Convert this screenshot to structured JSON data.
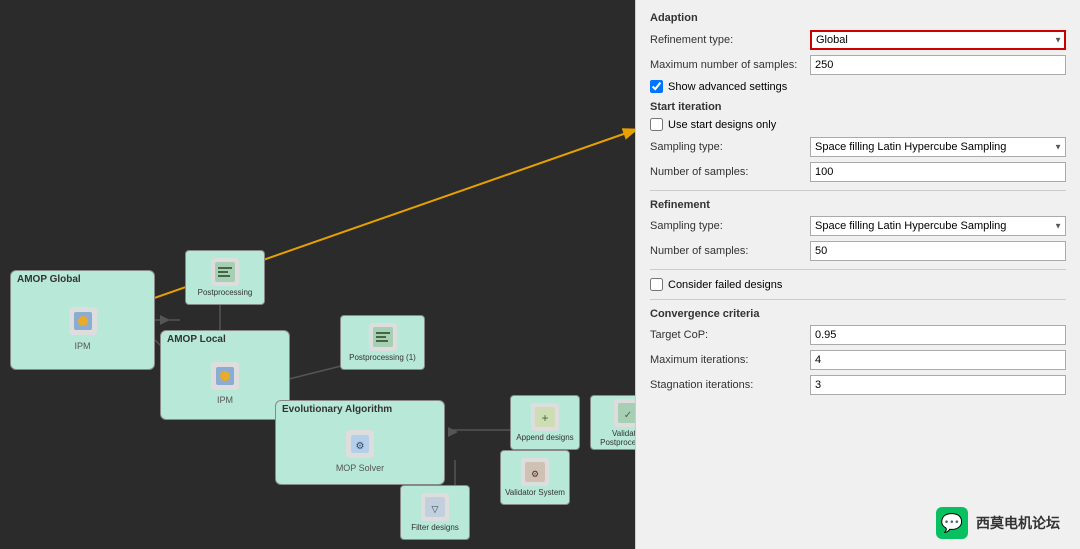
{
  "settings": {
    "section_adaption": "Adaption",
    "refinement_type_label": "Refinement type:",
    "refinement_type_value": "Global",
    "max_samples_label": "Maximum number of samples:",
    "max_samples_value": "250",
    "show_advanced_label": "Show advanced settings",
    "start_iteration_title": "Start iteration",
    "use_start_designs_label": "Use start designs only",
    "sampling_type_label": "Sampling type:",
    "sampling_type_value_start": "Space filling Latin Hypercube Sampling",
    "num_samples_label": "Number of samples:",
    "num_samples_value_start": "100",
    "refinement_title": "Refinement",
    "sampling_type_value_ref": "Space filling Latin Hypercube Sampling",
    "num_samples_value_ref": "50",
    "consider_failed_label": "Consider failed designs",
    "convergence_title": "Convergence criteria",
    "target_cop_label": "Target CoP:",
    "target_cop_value": "0.95",
    "max_iterations_label": "Maximum iterations:",
    "max_iterations_value": "4",
    "stagnation_label": "Stagnation iterations:",
    "stagnation_value": "3"
  },
  "workflow": {
    "nodes": {
      "amop_global_title": "AMOP Global",
      "amop_global_sub": "IPM",
      "postprocessing1_title": "Postprocessing",
      "amop_local_title": "AMOP Local",
      "amop_local_sub": "IPM",
      "postprocessing2_title": "Postprocessing (1)",
      "evolutionary_title": "Evolutionary Algorithm",
      "evolutionary_sub": "MOP Solver",
      "append_designs_title": "Append designs",
      "validator_postprocessing_title": "Validator Postprocessing",
      "validator_system_title": "Validator System",
      "filter_designs_title": "Filter designs"
    }
  },
  "watermark": {
    "icon_symbol": "💬",
    "text": "西莫电机论坛"
  }
}
